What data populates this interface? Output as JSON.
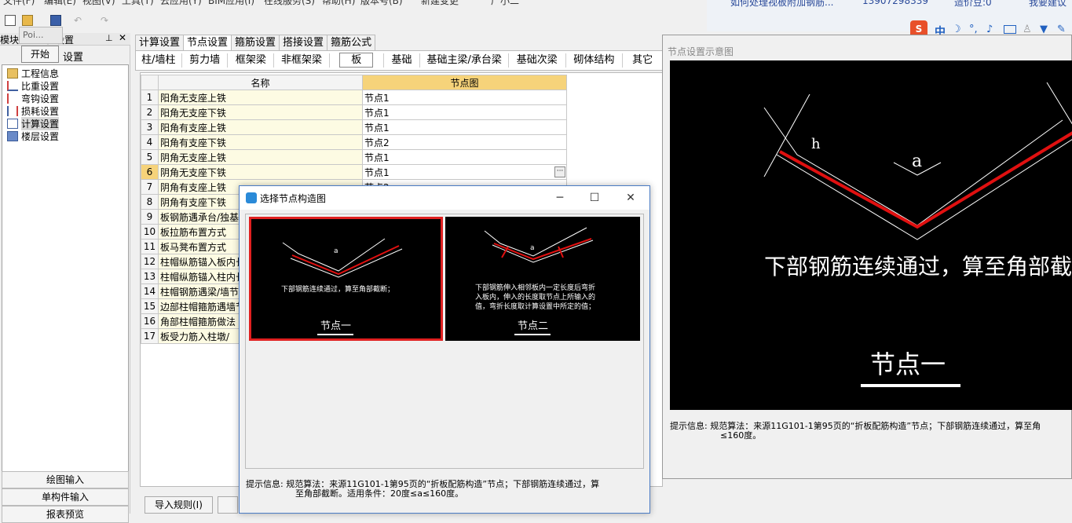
{
  "menu": [
    "文件(F)",
    "编辑(E)",
    "视图(V)",
    "工具(T)",
    "云应用(Y)",
    "BIM应用(I)",
    "在线服务(S)",
    "帮助(H)",
    "版本号(B)",
    "新建变更",
    "广小二"
  ],
  "topright": {
    "question": "如何处理视板附加钢筋...",
    "phone": "13907298339",
    "currency": "造价豆:0",
    "suggest": "我要建议"
  },
  "left_panel": {
    "header": "模块",
    "header_suffix": "程设置",
    "poi_label": "Poi...",
    "start_button": "开始",
    "start_suffix": "设置",
    "tree": [
      {
        "label": "工程信息",
        "icon": "info-icon"
      },
      {
        "label": "比重设置",
        "icon": "weight-icon"
      },
      {
        "label": "弯钩设置",
        "icon": "hook-icon"
      },
      {
        "label": "损耗设置",
        "icon": "loss-icon"
      },
      {
        "label": "计算设置",
        "icon": "calc-icon",
        "selected": true
      },
      {
        "label": "楼层设置",
        "icon": "floor-icon"
      }
    ],
    "nav": [
      "绘图输入",
      "单构件输入",
      "报表预览"
    ]
  },
  "tabs": [
    "计算设置",
    "节点设置",
    "箍筋设置",
    "搭接设置",
    "箍筋公式"
  ],
  "active_tab": 1,
  "subtabs": [
    "柱/墙柱",
    "剪力墙",
    "框架梁",
    "非框架梁",
    "板",
    "基础",
    "基础主梁/承台梁",
    "基础次梁",
    "砌体结构",
    "其它"
  ],
  "active_subtab": 4,
  "grid": {
    "headers": [
      "名称",
      "节点图"
    ],
    "rows": [
      {
        "num": "1",
        "name": "阳角无支座上铁",
        "value": "节点1"
      },
      {
        "num": "2",
        "name": "阳角无支座下铁",
        "value": "节点1"
      },
      {
        "num": "3",
        "name": "阳角有支座上铁",
        "value": "节点1"
      },
      {
        "num": "4",
        "name": "阳角有支座下铁",
        "value": "节点2"
      },
      {
        "num": "5",
        "name": "阴角无支座上铁",
        "value": "节点1"
      },
      {
        "num": "6",
        "name": "阴角无支座下铁",
        "value": "节点1"
      },
      {
        "num": "7",
        "name": "阴角有支座上铁",
        "value": "节点2"
      },
      {
        "num": "8",
        "name": "阴角有支座下铁",
        "value": ""
      },
      {
        "num": "9",
        "name": "板钢筋遇承台/独基",
        "value": ""
      },
      {
        "num": "10",
        "name": "板拉筋布置方式",
        "value": ""
      },
      {
        "num": "11",
        "name": "板马凳布置方式",
        "value": ""
      },
      {
        "num": "12",
        "name": "柱帽纵筋锚入板内长",
        "value": ""
      },
      {
        "num": "13",
        "name": "柱帽纵筋锚入柱内长",
        "value": ""
      },
      {
        "num": "14",
        "name": "柱帽钢筋遇梁/墙节",
        "value": ""
      },
      {
        "num": "15",
        "name": "边部柱帽箍筋遇墙节",
        "value": ""
      },
      {
        "num": "16",
        "name": "角部柱帽箍筋做法",
        "value": ""
      },
      {
        "num": "17",
        "name": "板受力筋入柱墩/",
        "value": ""
      }
    ]
  },
  "bottom_buttons": [
    "导入规则(I)",
    ""
  ],
  "preview": {
    "title": "节点设置示意图",
    "caption": "下部钢筋连续通过，算至角部截",
    "node_name": "节点一",
    "label_a": "a",
    "label_h": "h",
    "hint_label": "提示信息:",
    "hint_text": "规范算法：来源11G101-1第95页的“折板配筋构造”节点；下部钢筋连续通过，算至角",
    "hint_text2": "≤160度。"
  },
  "dialog": {
    "title": "选择节点构造图",
    "opt1_caption": "下部钢筋连续通过，算至角部截断；",
    "opt1_name": "节点一",
    "opt2_caption_1": "下部钢筋伸入相邻板内一定长度后弯折",
    "opt2_caption_2": "入板内，伸入的长度取节点上所输入的",
    "opt2_caption_3": "值，弯折长度取计算设置中所定的值；",
    "opt2_name": "节点二",
    "hint_label": "提示信息:",
    "hint_text": "规范算法：来源11G101-1第95页的“折板配筋构造”节点；下部钢筋连续通过，算",
    "hint_text2": "至角部截断。适用条件：20度≤a≤160度。"
  }
}
